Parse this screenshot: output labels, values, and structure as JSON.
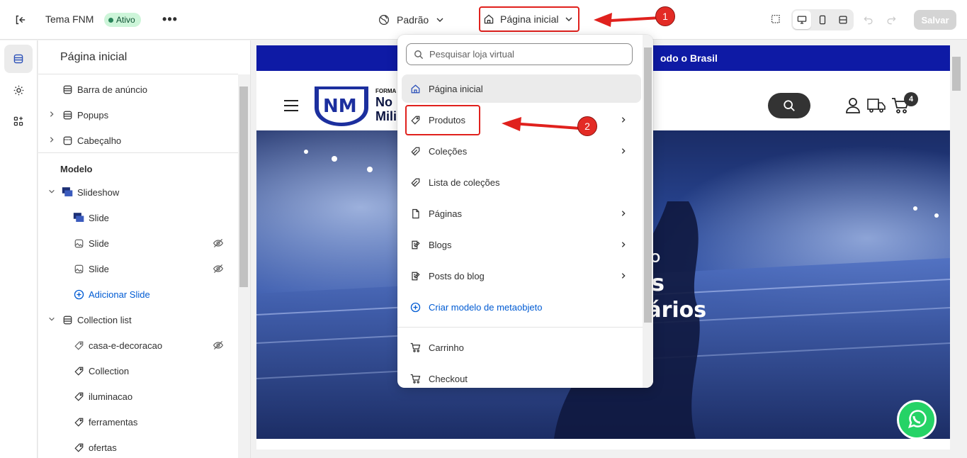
{
  "topbar": {
    "theme_name": "Tema FNM",
    "status_badge": "Ativo",
    "more_label": "•••",
    "market_label": "Padrão",
    "page_selector_label": "Página inicial",
    "save_label": "Salvar"
  },
  "sidebar": {
    "title": "Página inicial",
    "header_items": [
      {
        "label": "Barra de anúncio",
        "icon": "section-icon"
      },
      {
        "label": "Popups",
        "icon": "section-icon"
      },
      {
        "label": "Cabeçalho",
        "icon": "header-icon"
      }
    ],
    "section_title": "Modelo",
    "template_items": [
      {
        "label": "Slideshow",
        "icon": "slideshow-icon"
      },
      {
        "label": "Slide",
        "icon": "slide-icon"
      },
      {
        "label": "Slide",
        "icon": "image-icon"
      },
      {
        "label": "Slide",
        "icon": "image-icon"
      },
      {
        "label": "Adicionar Slide",
        "icon": "add-circle-icon"
      },
      {
        "label": "Collection list",
        "icon": "section-icon"
      },
      {
        "label": "casa-e-decoracao",
        "icon": "collection-icon"
      },
      {
        "label": "Collection",
        "icon": "collection-icon"
      },
      {
        "label": "iluminacao",
        "icon": "collection-icon"
      },
      {
        "label": "ferramentas",
        "icon": "collection-icon"
      },
      {
        "label": "ofertas",
        "icon": "collection-icon"
      }
    ]
  },
  "preview": {
    "announcement": "odo o Brasil",
    "logo_top": "FORMA",
    "logo_line1": "No",
    "logo_line2": "Mili",
    "cart_count": "4",
    "hero_line1": "os",
    "hero_line2": "nários",
    "hero_small": "O"
  },
  "dropdown": {
    "search_placeholder": "Pesquisar loja virtual",
    "items": [
      {
        "label": "Página inicial",
        "icon": "home-icon",
        "submenu": false
      },
      {
        "label": "Produtos",
        "icon": "tag-icon",
        "submenu": true
      },
      {
        "label": "Coleções",
        "icon": "collection-icon",
        "submenu": true
      },
      {
        "label": "Lista de coleções",
        "icon": "collection-icon",
        "submenu": false
      },
      {
        "label": "Páginas",
        "icon": "page-icon",
        "submenu": true
      },
      {
        "label": "Blogs",
        "icon": "blog-icon",
        "submenu": true
      },
      {
        "label": "Posts do blog",
        "icon": "blog-post-icon",
        "submenu": true
      },
      {
        "label": "Criar modelo de metaobjeto",
        "icon": "add-circle-icon",
        "submenu": false
      },
      {
        "label": "Carrinho",
        "icon": "cart-icon",
        "submenu": false
      },
      {
        "label": "Checkout",
        "icon": "cart-icon",
        "submenu": false
      }
    ]
  },
  "annotations": {
    "step1": "1",
    "step2": "2",
    "color": "#e0211d"
  }
}
